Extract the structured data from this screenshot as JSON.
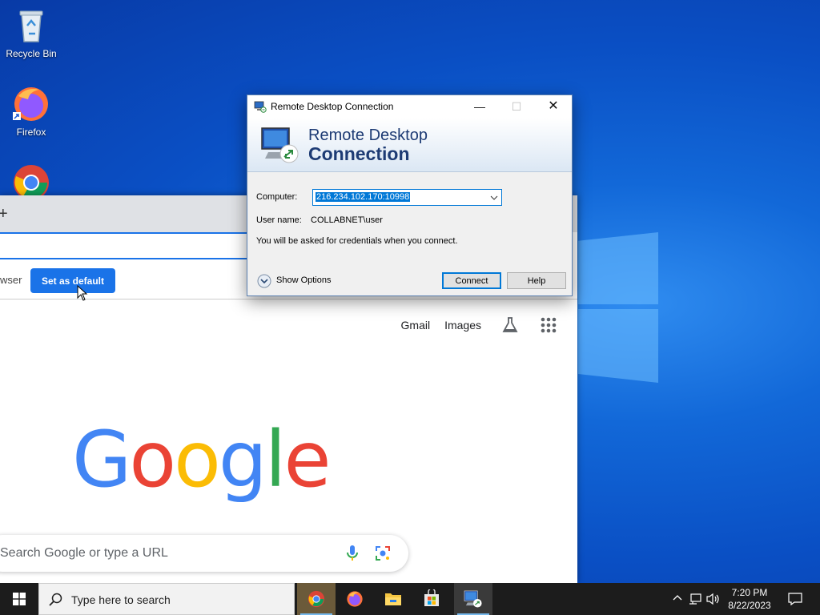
{
  "desktop": {
    "icons": [
      {
        "label": "Recycle Bin"
      },
      {
        "label": "Firefox"
      },
      {
        "label": "Google Chrome"
      }
    ]
  },
  "chrome": {
    "newtab_symbol": "+",
    "infobar": {
      "text_fragment": "wser",
      "button_label": "Set as default"
    },
    "ntp_links": {
      "gmail": "Gmail",
      "images": "Images"
    },
    "logo_letters": [
      {
        "ch": "G",
        "color": "#4285F4"
      },
      {
        "ch": "o",
        "color": "#EA4335"
      },
      {
        "ch": "o",
        "color": "#FBBC05"
      },
      {
        "ch": "g",
        "color": "#4285F4"
      },
      {
        "ch": "l",
        "color": "#34A853"
      },
      {
        "ch": "e",
        "color": "#EA4335"
      }
    ],
    "search_placeholder": "Search Google or type a URL"
  },
  "rdp": {
    "window_title": "Remote Desktop Connection",
    "banner_line1": "Remote Desktop",
    "banner_line2": "Connection",
    "computer_label": "Computer:",
    "computer_value": "216.234.102.170:10998",
    "username_label": "User name:",
    "username_value": "COLLABNET\\user",
    "info_text": "You will be asked for credentials when you connect.",
    "show_options": "Show Options",
    "connect_label": "Connect",
    "help_label": "Help"
  },
  "taskbar": {
    "search_placeholder": "Type here to search",
    "apps": [
      "chrome-icon",
      "firefox-icon",
      "file-explorer-icon",
      "microsoft-store-icon",
      "remote-desktop-icon"
    ],
    "time": "7:20 PM",
    "date": "8/22/2023"
  },
  "colors": {
    "accent": "#1a73e8",
    "rdp_selection": "#0078d7",
    "taskbar": "#1c1c1c"
  }
}
